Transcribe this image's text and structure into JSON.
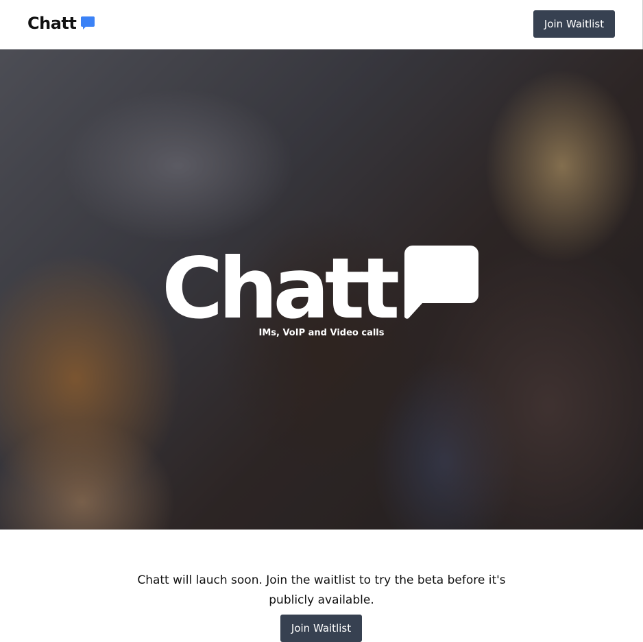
{
  "header": {
    "brand": "Chatt",
    "brand_icon": "chat-bubble-icon",
    "join_label": "Join Waitlist"
  },
  "hero": {
    "title": "Chatt",
    "title_icon": "chat-bubble-icon",
    "subtitle": "IMs, VoIP and Video calls"
  },
  "cta": {
    "text": "Chatt will lauch soon. Join the waitlist to try the beta before it's publicly available.",
    "join_label": "Join Waitlist"
  },
  "colors": {
    "button_bg": "#374151",
    "brand_icon": "#3b82f6",
    "hero_text": "#ffffff"
  }
}
